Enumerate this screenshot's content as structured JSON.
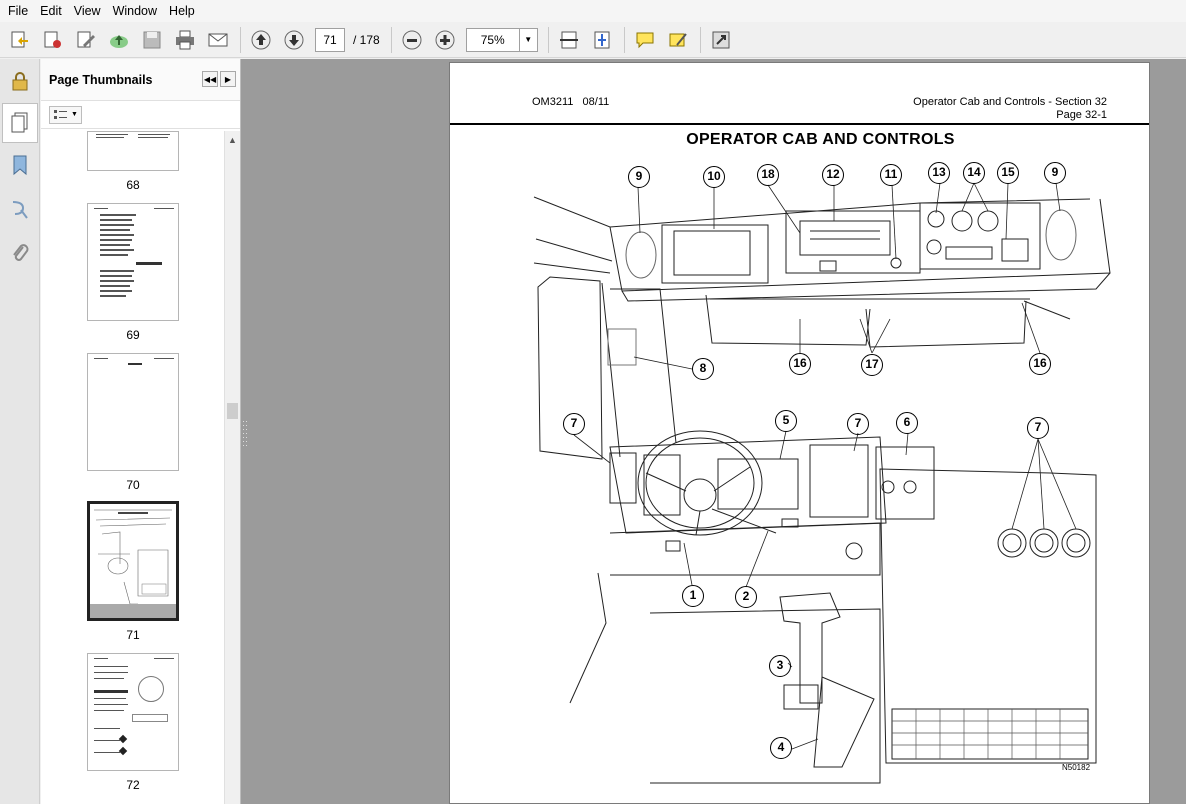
{
  "menubar": {
    "items": [
      "File",
      "Edit",
      "View",
      "Window",
      "Help"
    ]
  },
  "toolbar": {
    "buttons": [
      "create-pdf-icon",
      "pdf-settings-icon",
      "edit-icon",
      "upload-icon",
      "save-icon",
      "print-icon",
      "email-icon",
      "previous-page-icon",
      "next-page-icon",
      "zoom-out-icon",
      "zoom-in-icon",
      "fit-width-icon",
      "fit-page-icon",
      "comment-icon",
      "highlight-icon",
      "fullscreen-icon"
    ],
    "current_page": "71",
    "page_total": "/ 178",
    "zoom": "75%"
  },
  "thumbnails": {
    "title": "Page Thumbnails",
    "pages": [
      "68",
      "69",
      "70",
      "71",
      "72"
    ],
    "selected": "71"
  },
  "document": {
    "header_left": "OM3211   08/11",
    "header_right_1": "Operator Cab and Controls - Section 32",
    "header_right_2": "Page 32-1",
    "title": "OPERATOR CAB AND CONTROLS",
    "figure_id": "N50182",
    "callouts": [
      "9",
      "10",
      "18",
      "12",
      "11",
      "13",
      "14",
      "15",
      "9",
      "8",
      "16",
      "17",
      "16",
      "7",
      "5",
      "7",
      "6",
      "7",
      "1",
      "2",
      "3",
      "4"
    ]
  },
  "colors": {
    "workspace": "#9b9b9b",
    "page": "#ffffff",
    "panel": "#ffffff"
  }
}
